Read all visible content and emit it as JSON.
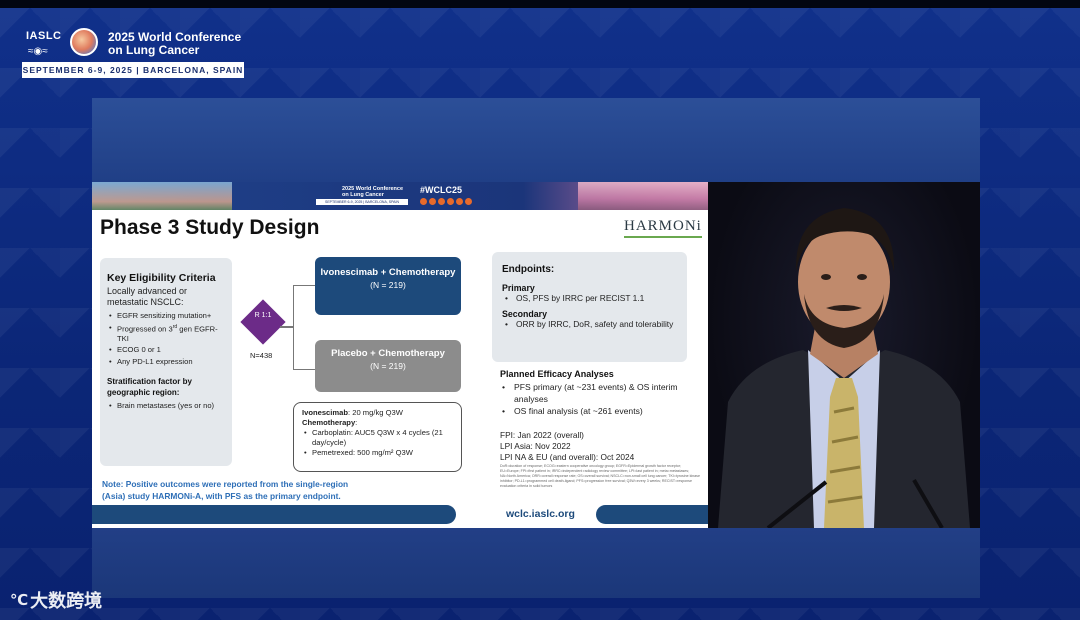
{
  "conference": {
    "org": "IASLC",
    "title": "2025 World Conference on Lung Cancer",
    "date_location": "SEPTEMBER 6-9, 2025 | BARCELONA, SPAIN"
  },
  "slide": {
    "mini_logo_title": "2025 World Conference on Lung Cancer",
    "mini_logo_date": "SEPTEMBER 6-9, 2025 | BARCELONA, SPAIN",
    "hashtag": "#WCLC25",
    "title": "Phase 3 Study Design",
    "brand": "HARMONi",
    "eligibility": {
      "heading": "Key Eligibility Criteria",
      "subheading": "Locally advanced or metastatic NSCLC:",
      "items": [
        "EGFR sensitizing mutation+",
        "Progressed on 3rd gen EGFR-TKI",
        "ECOG 0 or 1",
        "Any PD-L1 expression"
      ],
      "strat_heading": "Stratification factor by geographic region:",
      "strat_items": [
        "Brain metastases (yes or no)"
      ]
    },
    "randomization": {
      "ratio": "R 1:1",
      "n": "N=438"
    },
    "arms": [
      {
        "title": "Ivonescimab + Chemotherapy",
        "n": "(N = 219)"
      },
      {
        "title": "Placebo + Chemotherapy",
        "n": "(N = 219)"
      }
    ],
    "dosing": {
      "drug_label": "Ivonescimab",
      "drug_dose": ": 20 mg/kg Q3W",
      "chemo_label": "Chemotherapy",
      "chemo_items": [
        "Carboplatin: AUC5 Q3W x 4 cycles (21 day/cycle)",
        "Pemetrexed: 500 mg/m² Q3W"
      ]
    },
    "endpoints": {
      "heading": "Endpoints:",
      "primary_label": "Primary",
      "primary_items": [
        "OS, PFS by IRRC per RECIST 1.1"
      ],
      "secondary_label": "Secondary",
      "secondary_items": [
        "ORR by IRRC, DoR, safety and tolerability"
      ]
    },
    "planned_analyses": {
      "heading": "Planned Efficacy Analyses",
      "items": [
        "PFS primary (at ~231 events) & OS interim analyses",
        "OS final analysis (at ~261 events)"
      ]
    },
    "dates": [
      "FPI: Jan 2022 (overall)",
      "LPI Asia: Nov 2022",
      "LPI NA & EU (and overall): Oct 2024"
    ],
    "abbreviations": "DoR=duration of response; ECOG=eastern cooperative oncology group; EGFR=Epidermal growth factor receptor; EU=Europe; FPI=first patient in; IRRC=independent radiology review committee; LPI=last patient in; meta=metastases; NA=North America; ORR=overall response rate; OS=overall survival; NSCLC=non-small cell lung cancer; TKI=tyrosine kinase inhibitor; PD-L1=programmed cell death-ligand; PFS=progression free survival; Q3W=every 3 weeks; RECIST=response evaluation criteria in solid tumors",
    "note": "Note: Positive outcomes were reported from the single-region (Asia) study HARMONi-A, with PFS as the primary endpoint.",
    "footer_url": "wclc.iaslc.org"
  },
  "watermark": "大数跨境",
  "colors": {
    "navy": "#1d4a7b",
    "purple": "#6c2b88",
    "gray_arm": "#8c8c8c",
    "note_blue": "#2e6fb7",
    "background": "#0d2a7a"
  }
}
